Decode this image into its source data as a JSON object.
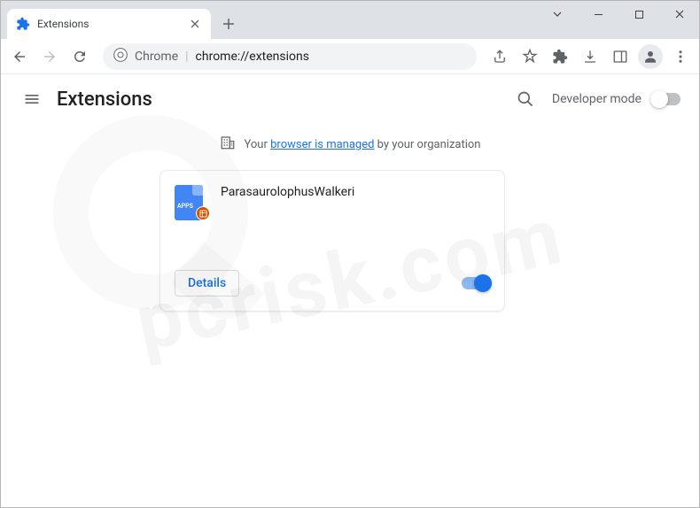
{
  "window": {
    "tab_title": "Extensions",
    "address_prefix": "Chrome",
    "address_url": "chrome://extensions"
  },
  "header": {
    "title": "Extensions",
    "dev_mode_label": "Developer mode"
  },
  "notice": {
    "prefix": "Your ",
    "link": "browser is managed",
    "suffix": " by your organization"
  },
  "extension": {
    "name": "ParasaurolophusWalkeri",
    "icon_text": "APPS",
    "details_label": "Details",
    "enabled": true
  },
  "watermark": "pcrisk.com"
}
